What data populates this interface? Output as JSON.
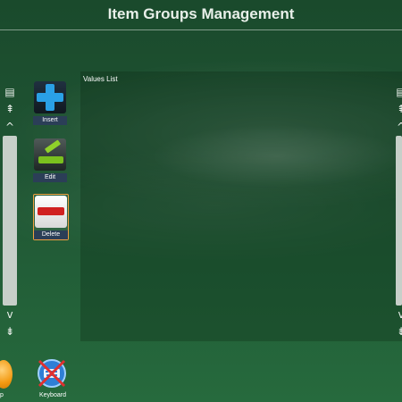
{
  "window": {
    "title": "Item Groups Management"
  },
  "toolbar": {
    "insert_label": "Insert",
    "edit_label": "Edit",
    "delete_label": "Delete",
    "selected": "Delete"
  },
  "values_panel": {
    "label": "Values List"
  },
  "scroll_icons": {
    "page_top": "▤",
    "page_up": "⇞",
    "line_up": "^",
    "line_down": "v",
    "page_down": "⇟"
  },
  "bottom_bar": {
    "left_item_label": "p",
    "keyboard_label": "Keyboard"
  },
  "colors": {
    "background": "#1f5433",
    "accent_selected": "#f0a040",
    "label_bar": "#2b3e57"
  }
}
